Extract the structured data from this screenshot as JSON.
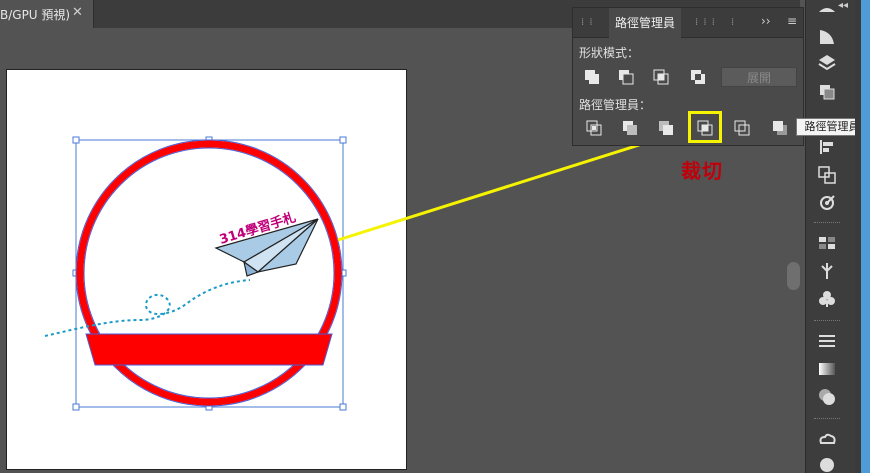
{
  "document_tab": {
    "title": "B/GPU 預視)",
    "close_label": "✕"
  },
  "pathfinder_panel": {
    "tab_label": "路徑管理員",
    "overflow_label": "››",
    "menu_label": "≡",
    "shape_modes_label": "形狀模式：",
    "pathfinders_label": "路徑管理員：",
    "expand_label": "展開",
    "shape_mode_buttons": [
      "unite-icon",
      "minus-front-icon",
      "intersect-icon",
      "exclude-icon"
    ],
    "pathfinder_buttons": [
      "divide-icon",
      "trim-icon",
      "merge-icon",
      "crop-icon",
      "outline-icon",
      "minus-back-icon"
    ]
  },
  "annotation": {
    "crop_label": "裁切",
    "highlight_color": "#f6f300",
    "label_color": "#c0000a"
  },
  "tooltip": {
    "text": "路徑管理員"
  },
  "artwork": {
    "logo_text": "314學習手札",
    "circle_color": "#ff0000",
    "plane_color": "#a9cbe6",
    "text_color": "#c0007a",
    "trail_color": "#1c9bc7"
  },
  "toolbar_icons": [
    "shape-icon",
    "align-icon",
    "layers-icon",
    "pathfinder-icon",
    "transform-icon",
    "align-panel-icon",
    "transparency-icon",
    "links-icon",
    "swatches-icon",
    "symbols-icon",
    "brushes-icon",
    "stroke-icon",
    "gradient-icon",
    "appearance-icon",
    "cc-libraries-icon",
    "color-icon"
  ],
  "colors": {
    "ui_bg": "#535353",
    "panel_bg": "#4a4a4a",
    "toolbar_bg": "#3d3d3d",
    "accent_strip": "#4f9bd8"
  }
}
